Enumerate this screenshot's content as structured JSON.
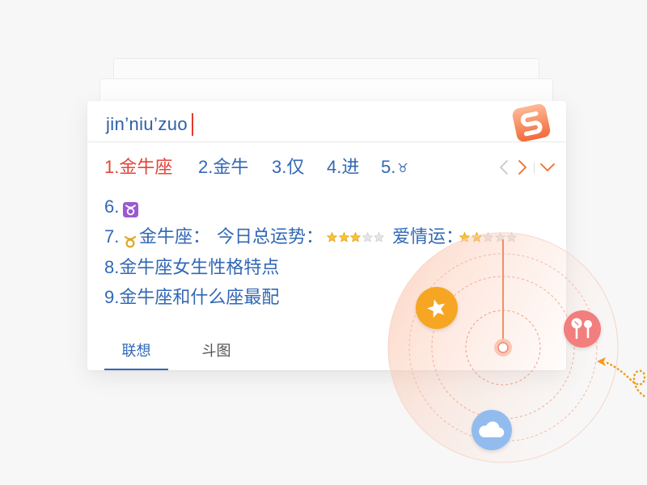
{
  "composition": {
    "text": "jin’niu’zuo"
  },
  "logo": {
    "letter": "S",
    "icon": "sogou-logo-icon"
  },
  "candidates": [
    {
      "label": "1.金牛座",
      "selected": true
    },
    {
      "label": "2.金牛",
      "selected": false
    },
    {
      "label": "3.仅",
      "selected": false
    },
    {
      "label": "4.进",
      "selected": false
    },
    {
      "label": "5.",
      "symbol": "♉",
      "selected": false
    }
  ],
  "pager": {
    "prev_icon": "chevron-left-icon",
    "prev_enabled": false,
    "next_icon": "chevron-right-icon",
    "next_enabled": true,
    "expand_icon": "chevron-down-icon"
  },
  "more_candidates": {
    "row6": {
      "index": "6.",
      "icon": "taurus-emoji-icon"
    },
    "row7": {
      "index": "7.",
      "icon": "taurus-gold-icon",
      "title": "金牛座：",
      "fortune": {
        "label": "今日总运势：",
        "stars": 3,
        "max": 5
      },
      "love": {
        "label": "爱情运：",
        "stars": 2,
        "max": 5
      }
    },
    "row8": {
      "label": "8.金牛座女生性格特点"
    },
    "row9": {
      "label": "9.金牛座和什么座最配"
    }
  },
  "tabs": [
    {
      "label": "联想",
      "active": true
    },
    {
      "label": "斗图",
      "active": false
    }
  ],
  "decorations": {
    "icons": [
      "radar-target-icon",
      "star-badge-icon",
      "lollipop-badge-icon",
      "cloud-badge-icon",
      "dotted-path-arrow-icon"
    ]
  },
  "colors": {
    "selected": "#e5453b",
    "candidate": "#3268b5",
    "composition": "#2d5fa8",
    "cursor": "#e33b30",
    "accent": "#f26b2b",
    "star_filled": "#f9c433",
    "star_filled_edge": "#e3a41d",
    "star_empty": "#e6e6e6",
    "star_empty_edge": "#cfcfcf",
    "tab_active": "#3268b5",
    "tab_inactive": "#555555",
    "emoji_purple": "#9b59d0",
    "taurus_gold": "#e0a526",
    "badge_orange": "#f6a623",
    "badge_pink": "#f27e7e",
    "badge_blue": "#93bcee",
    "radar": "#f08361"
  }
}
